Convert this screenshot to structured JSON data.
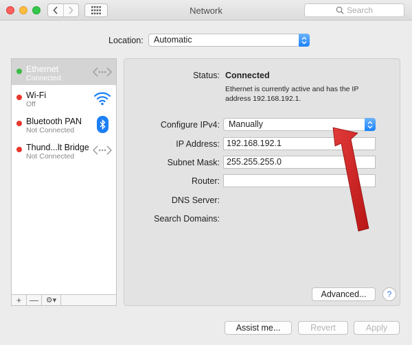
{
  "window": {
    "title": "Network",
    "search_placeholder": "Search"
  },
  "location": {
    "label": "Location:",
    "value": "Automatic"
  },
  "services": [
    {
      "name": "Ethernet",
      "status": "Connected",
      "state": "green",
      "icon": "ethernet-icon",
      "selected": true
    },
    {
      "name": "Wi-Fi",
      "status": "Off",
      "state": "red",
      "icon": "wifi-icon"
    },
    {
      "name": "Bluetooth PAN",
      "status": "Not Connected",
      "state": "red",
      "icon": "bluetooth-icon"
    },
    {
      "name": "Thund...lt Bridge",
      "status": "Not Connected",
      "state": "red",
      "icon": "ethernet-icon"
    }
  ],
  "sidebar_footer": {
    "add": "+",
    "remove": "—",
    "gear": "⚙▾"
  },
  "detail": {
    "status_label": "Status:",
    "status_value": "Connected",
    "status_desc": "Ethernet is currently active and has the IP address 192.168.192.1.",
    "configure_label": "Configure IPv4:",
    "configure_value": "Manually",
    "ip_label": "IP Address:",
    "ip_value": "192.168.192.1",
    "subnet_label": "Subnet Mask:",
    "subnet_value": "255.255.255.0",
    "router_label": "Router:",
    "router_value": "",
    "dns_label": "DNS Server:",
    "search_domains_label": "Search Domains:",
    "advanced": "Advanced...",
    "help": "?"
  },
  "footer": {
    "assist": "Assist me...",
    "revert": "Revert",
    "apply": "Apply"
  },
  "colors": {
    "accent": "#1a82fb",
    "annotation_arrow": "#d42020"
  }
}
